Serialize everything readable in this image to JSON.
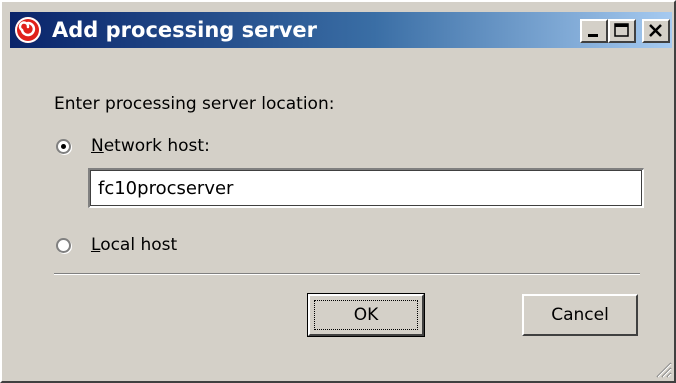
{
  "window": {
    "title": "Add processing server",
    "icon": "app-red-swirl-icon",
    "controls": [
      "minimize-icon",
      "maximize-icon",
      "close-icon"
    ]
  },
  "form": {
    "prompt": "Enter processing server location:",
    "options": [
      {
        "label_ul": "N",
        "label_rest": "etwork host:",
        "selected": true
      },
      {
        "label_ul": "L",
        "label_rest": "ocal host",
        "selected": false
      }
    ],
    "network_host_value": "fc10procserver"
  },
  "buttons": {
    "ok": "OK",
    "cancel": "Cancel"
  },
  "colors": {
    "title_gradient_start": "#0a246a",
    "title_gradient_end": "#a6caf0",
    "dialog_bg": "#d4d0c8",
    "icon_red": "#e0201a"
  }
}
